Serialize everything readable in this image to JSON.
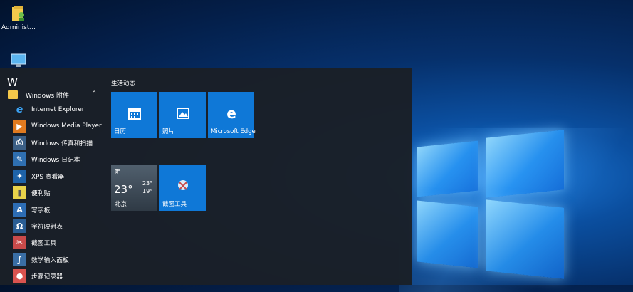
{
  "desktop": {
    "admin_label": "Administ...",
    "computer_label": ""
  },
  "start_menu": {
    "section_letter": "W",
    "group": {
      "label": "Windows 附件",
      "icon": "folder-icon"
    },
    "apps": [
      {
        "label": "Internet Explorer",
        "icon": "internet-explorer-icon"
      },
      {
        "label": "Windows Media Player",
        "icon": "media-player-icon"
      },
      {
        "label": "Windows 传真和扫描",
        "icon": "fax-scan-icon"
      },
      {
        "label": "Windows 日记本",
        "icon": "journal-icon"
      },
      {
        "label": "XPS 查看器",
        "icon": "xps-viewer-icon"
      },
      {
        "label": "便利贴",
        "icon": "sticky-notes-icon"
      },
      {
        "label": "写字板",
        "icon": "wordpad-icon"
      },
      {
        "label": "字符映射表",
        "icon": "character-map-icon"
      },
      {
        "label": "截图工具",
        "icon": "snipping-tool-icon"
      },
      {
        "label": "数学输入面板",
        "icon": "math-input-icon"
      },
      {
        "label": "步骤记录器",
        "icon": "steps-recorder-icon"
      }
    ],
    "tiles_section_title": "生活动态",
    "tiles": {
      "calendar": "日历",
      "photos": "照片",
      "edge": "Microsoft Edge",
      "snipping": "截图工具"
    },
    "weather": {
      "condition": "阴",
      "temp": "23°",
      "high": "23°",
      "low": "19°",
      "city": "北京"
    }
  },
  "colors": {
    "tile_blue": "#0f78d7",
    "menu_bg": "#1a1f26",
    "folder_yellow": "#f4c84a"
  }
}
